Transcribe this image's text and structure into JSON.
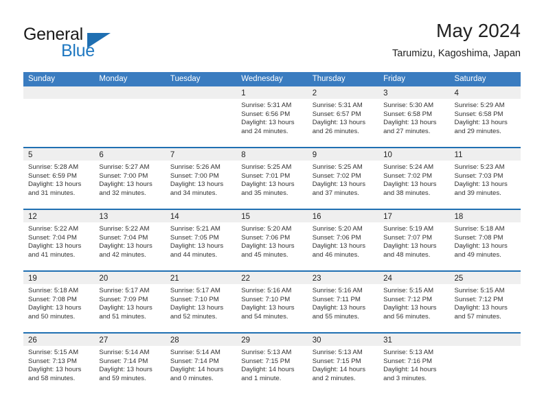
{
  "brand": {
    "name_part1": "General",
    "name_part2": "Blue"
  },
  "header": {
    "title": "May 2024",
    "subtitle": "Tarumizu, Kagoshima, Japan"
  },
  "calendar": {
    "weekday_headers": [
      "Sunday",
      "Monday",
      "Tuesday",
      "Wednesday",
      "Thursday",
      "Friday",
      "Saturday"
    ],
    "accent_color": "#3a7cc0",
    "separator_color": "#1f6fb2",
    "day_band_color": "#efefef",
    "weeks": [
      [
        {
          "day": "",
          "sunrise": "",
          "sunset": "",
          "daylight": "",
          "empty": true
        },
        {
          "day": "",
          "sunrise": "",
          "sunset": "",
          "daylight": "",
          "empty": true
        },
        {
          "day": "",
          "sunrise": "",
          "sunset": "",
          "daylight": "",
          "empty": true
        },
        {
          "day": "1",
          "sunrise": "Sunrise: 5:31 AM",
          "sunset": "Sunset: 6:56 PM",
          "daylight": "Daylight: 13 hours and 24 minutes."
        },
        {
          "day": "2",
          "sunrise": "Sunrise: 5:31 AM",
          "sunset": "Sunset: 6:57 PM",
          "daylight": "Daylight: 13 hours and 26 minutes."
        },
        {
          "day": "3",
          "sunrise": "Sunrise: 5:30 AM",
          "sunset": "Sunset: 6:58 PM",
          "daylight": "Daylight: 13 hours and 27 minutes."
        },
        {
          "day": "4",
          "sunrise": "Sunrise: 5:29 AM",
          "sunset": "Sunset: 6:58 PM",
          "daylight": "Daylight: 13 hours and 29 minutes."
        }
      ],
      [
        {
          "day": "5",
          "sunrise": "Sunrise: 5:28 AM",
          "sunset": "Sunset: 6:59 PM",
          "daylight": "Daylight: 13 hours and 31 minutes."
        },
        {
          "day": "6",
          "sunrise": "Sunrise: 5:27 AM",
          "sunset": "Sunset: 7:00 PM",
          "daylight": "Daylight: 13 hours and 32 minutes."
        },
        {
          "day": "7",
          "sunrise": "Sunrise: 5:26 AM",
          "sunset": "Sunset: 7:00 PM",
          "daylight": "Daylight: 13 hours and 34 minutes."
        },
        {
          "day": "8",
          "sunrise": "Sunrise: 5:25 AM",
          "sunset": "Sunset: 7:01 PM",
          "daylight": "Daylight: 13 hours and 35 minutes."
        },
        {
          "day": "9",
          "sunrise": "Sunrise: 5:25 AM",
          "sunset": "Sunset: 7:02 PM",
          "daylight": "Daylight: 13 hours and 37 minutes."
        },
        {
          "day": "10",
          "sunrise": "Sunrise: 5:24 AM",
          "sunset": "Sunset: 7:02 PM",
          "daylight": "Daylight: 13 hours and 38 minutes."
        },
        {
          "day": "11",
          "sunrise": "Sunrise: 5:23 AM",
          "sunset": "Sunset: 7:03 PM",
          "daylight": "Daylight: 13 hours and 39 minutes."
        }
      ],
      [
        {
          "day": "12",
          "sunrise": "Sunrise: 5:22 AM",
          "sunset": "Sunset: 7:04 PM",
          "daylight": "Daylight: 13 hours and 41 minutes."
        },
        {
          "day": "13",
          "sunrise": "Sunrise: 5:22 AM",
          "sunset": "Sunset: 7:04 PM",
          "daylight": "Daylight: 13 hours and 42 minutes."
        },
        {
          "day": "14",
          "sunrise": "Sunrise: 5:21 AM",
          "sunset": "Sunset: 7:05 PM",
          "daylight": "Daylight: 13 hours and 44 minutes."
        },
        {
          "day": "15",
          "sunrise": "Sunrise: 5:20 AM",
          "sunset": "Sunset: 7:06 PM",
          "daylight": "Daylight: 13 hours and 45 minutes."
        },
        {
          "day": "16",
          "sunrise": "Sunrise: 5:20 AM",
          "sunset": "Sunset: 7:06 PM",
          "daylight": "Daylight: 13 hours and 46 minutes."
        },
        {
          "day": "17",
          "sunrise": "Sunrise: 5:19 AM",
          "sunset": "Sunset: 7:07 PM",
          "daylight": "Daylight: 13 hours and 48 minutes."
        },
        {
          "day": "18",
          "sunrise": "Sunrise: 5:18 AM",
          "sunset": "Sunset: 7:08 PM",
          "daylight": "Daylight: 13 hours and 49 minutes."
        }
      ],
      [
        {
          "day": "19",
          "sunrise": "Sunrise: 5:18 AM",
          "sunset": "Sunset: 7:08 PM",
          "daylight": "Daylight: 13 hours and 50 minutes."
        },
        {
          "day": "20",
          "sunrise": "Sunrise: 5:17 AM",
          "sunset": "Sunset: 7:09 PM",
          "daylight": "Daylight: 13 hours and 51 minutes."
        },
        {
          "day": "21",
          "sunrise": "Sunrise: 5:17 AM",
          "sunset": "Sunset: 7:10 PM",
          "daylight": "Daylight: 13 hours and 52 minutes."
        },
        {
          "day": "22",
          "sunrise": "Sunrise: 5:16 AM",
          "sunset": "Sunset: 7:10 PM",
          "daylight": "Daylight: 13 hours and 54 minutes."
        },
        {
          "day": "23",
          "sunrise": "Sunrise: 5:16 AM",
          "sunset": "Sunset: 7:11 PM",
          "daylight": "Daylight: 13 hours and 55 minutes."
        },
        {
          "day": "24",
          "sunrise": "Sunrise: 5:15 AM",
          "sunset": "Sunset: 7:12 PM",
          "daylight": "Daylight: 13 hours and 56 minutes."
        },
        {
          "day": "25",
          "sunrise": "Sunrise: 5:15 AM",
          "sunset": "Sunset: 7:12 PM",
          "daylight": "Daylight: 13 hours and 57 minutes."
        }
      ],
      [
        {
          "day": "26",
          "sunrise": "Sunrise: 5:15 AM",
          "sunset": "Sunset: 7:13 PM",
          "daylight": "Daylight: 13 hours and 58 minutes."
        },
        {
          "day": "27",
          "sunrise": "Sunrise: 5:14 AM",
          "sunset": "Sunset: 7:14 PM",
          "daylight": "Daylight: 13 hours and 59 minutes."
        },
        {
          "day": "28",
          "sunrise": "Sunrise: 5:14 AM",
          "sunset": "Sunset: 7:14 PM",
          "daylight": "Daylight: 14 hours and 0 minutes."
        },
        {
          "day": "29",
          "sunrise": "Sunrise: 5:13 AM",
          "sunset": "Sunset: 7:15 PM",
          "daylight": "Daylight: 14 hours and 1 minute."
        },
        {
          "day": "30",
          "sunrise": "Sunrise: 5:13 AM",
          "sunset": "Sunset: 7:15 PM",
          "daylight": "Daylight: 14 hours and 2 minutes."
        },
        {
          "day": "31",
          "sunrise": "Sunrise: 5:13 AM",
          "sunset": "Sunset: 7:16 PM",
          "daylight": "Daylight: 14 hours and 3 minutes."
        },
        {
          "day": "",
          "sunrise": "",
          "sunset": "",
          "daylight": "",
          "empty": true
        }
      ]
    ]
  }
}
